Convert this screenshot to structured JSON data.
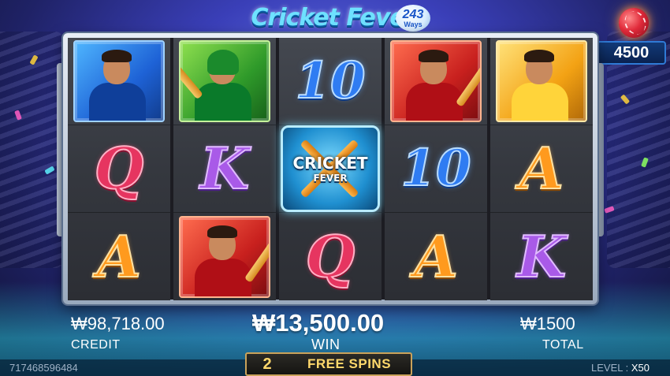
{
  "logo": {
    "title": "Cricket Fever",
    "ways_number": "243",
    "ways_label": "Ways"
  },
  "bonus_ball": {
    "value": "4500"
  },
  "reels": [
    [
      "card-blue-player",
      "Q",
      "A"
    ],
    [
      "card-green-batsman",
      "K",
      "card-red-batsman"
    ],
    [
      "10",
      "wild",
      "Q"
    ],
    [
      "card-red-batsman",
      "10",
      "A"
    ],
    [
      "card-gold-player",
      "A",
      "K"
    ]
  ],
  "wild": {
    "line1": "CRICKET",
    "line2": "FEVER"
  },
  "credit": {
    "amount": "₩98,718.00",
    "label": "CREDIT"
  },
  "win": {
    "amount": "₩13,500.00",
    "label": "WIN"
  },
  "total": {
    "amount": "₩1500",
    "label": "TOTAL"
  },
  "free_spins": {
    "count": "2",
    "label": "FREE SPINS"
  },
  "footer": {
    "session_id": "717468596484",
    "level_label": "LEVEL : ",
    "level_value": "X50"
  },
  "colors": {
    "q_symbol": "#e63560",
    "k_symbol": "#a95ae8",
    "a_symbol": "#ff9a1e",
    "ten_symbol": "#2f7cf2",
    "free_spins_gold": "#ffd86b"
  }
}
